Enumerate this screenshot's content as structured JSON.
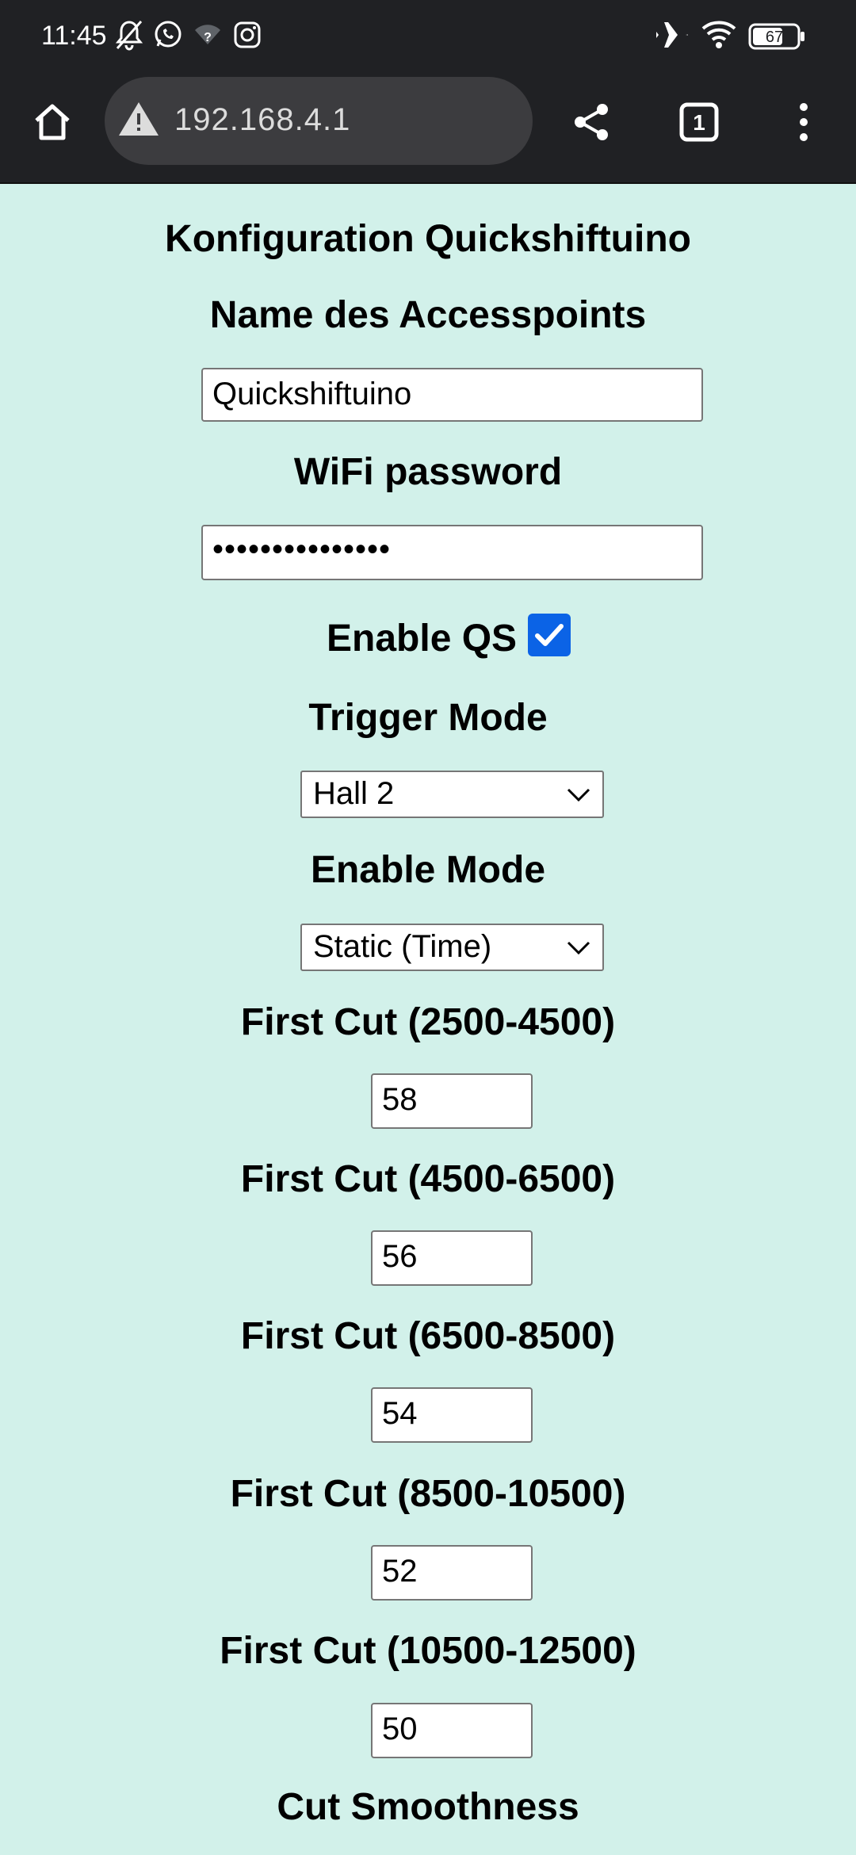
{
  "status_bar": {
    "time": "11:45",
    "battery": "67",
    "icons": [
      "bell-off-icon",
      "whatsapp-icon",
      "wifi-unknown-icon",
      "instagram-icon",
      "airplane-icon",
      "wifi-icon",
      "battery-icon"
    ]
  },
  "browser": {
    "url": "192.168.4.1",
    "tab_count": "1",
    "icons": [
      "home-icon",
      "warning-icon",
      "share-icon",
      "tabs-icon",
      "more-icon"
    ]
  },
  "form": {
    "title": "Konfiguration Quickshiftuino",
    "ap_name_label": "Name des Accesspoints",
    "ap_name_value": "Quickshiftuino",
    "wifi_password_label": "WiFi password",
    "wifi_password_value": "•••••••••••••••",
    "enable_qs_label": "Enable QS",
    "enable_qs_checked": true,
    "trigger_mode_label": "Trigger Mode",
    "trigger_mode_value": "Hall 2",
    "enable_mode_label": "Enable Mode",
    "enable_mode_value": "Static (Time)",
    "cuts": [
      {
        "label": "First Cut (2500-4500)",
        "value": "58"
      },
      {
        "label": "First Cut (4500-6500)",
        "value": "56"
      },
      {
        "label": "First Cut (6500-8500)",
        "value": "54"
      },
      {
        "label": "First Cut (8500-10500)",
        "value": "52"
      },
      {
        "label": "First Cut (10500-12500)",
        "value": "50"
      }
    ],
    "cut_smoothness_label": "Cut Smoothness"
  },
  "colors": {
    "page_bg": "#d2f1ea",
    "browser_bg": "#202124",
    "checkbox_accent": "#0b63e6"
  }
}
